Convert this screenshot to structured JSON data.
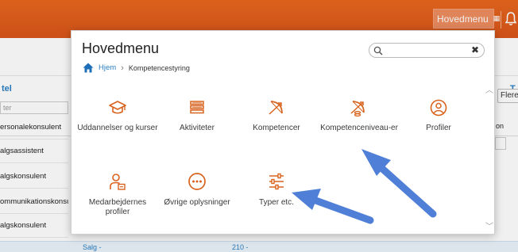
{
  "topbar": {
    "menu_button_label": "Hovedmenu",
    "accent_color": "#e4631d"
  },
  "background": {
    "column_header_1": "tel",
    "column_header_right": "T",
    "filter_placeholder": "ter",
    "flere_button": "Flere",
    "rows": [
      "ersonalekonsulent",
      "algsassistent",
      "algskonsulent",
      "ommunikationskonsulent",
      "algskonsulent"
    ],
    "right_col_text": "on",
    "bottom_text_1": "Salg -",
    "bottom_text_2": "210 -"
  },
  "menu": {
    "title": "Hovedmenu",
    "search": {
      "placeholder": "",
      "clear_icon": "close-icon"
    },
    "breadcrumb": {
      "home": "Hjem",
      "current": "Kompetencestyring"
    },
    "tiles": [
      {
        "label": "Uddannelser og kurser",
        "icon": "graduation-cap-icon"
      },
      {
        "label": "Aktiviteter",
        "icon": "stack-icon"
      },
      {
        "label": "Kompetencer",
        "icon": "bow-arrow-icon"
      },
      {
        "label": "Kompetenceniveau-er",
        "icon": "bow-arrow-coins-icon"
      },
      {
        "label": "Profiler",
        "icon": "user-circle-icon"
      },
      {
        "label": "Medarbejdernes profiler",
        "icon": "user-card-icon"
      },
      {
        "label": "Øvrige oplysninger",
        "icon": "more-circle-icon"
      },
      {
        "label": "Typer etc.",
        "icon": "sliders-icon"
      }
    ],
    "icon_color": "#d9631e",
    "annotation_arrow_color": "#4f7fd6"
  }
}
